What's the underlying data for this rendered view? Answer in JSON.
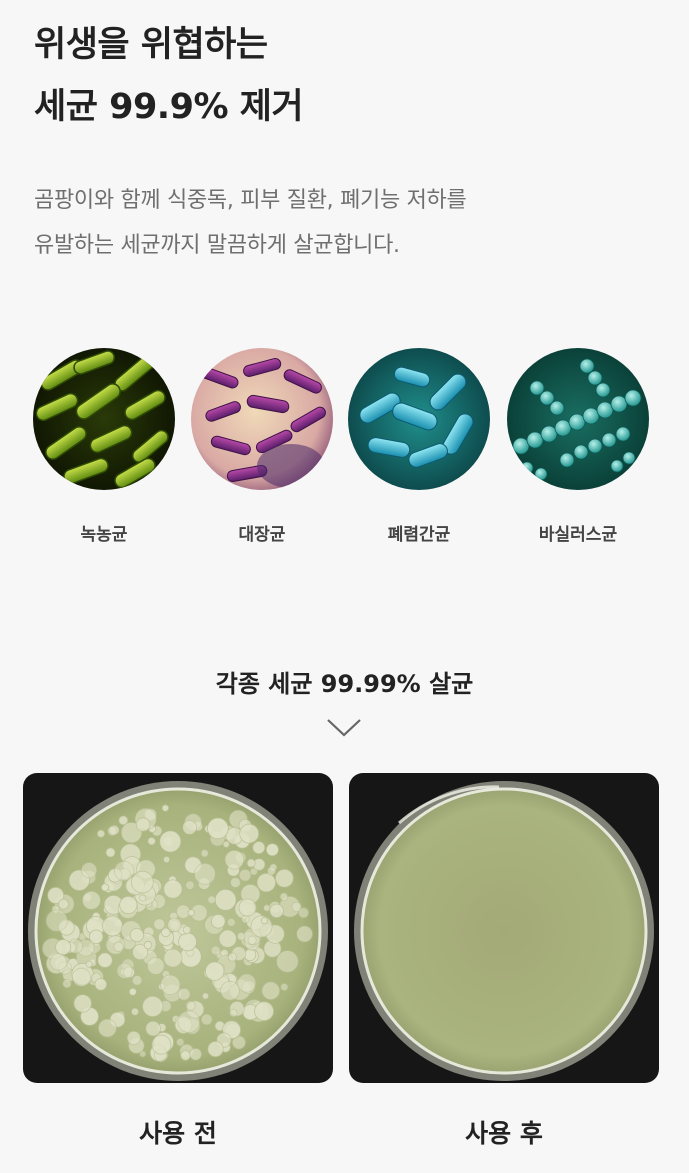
{
  "headline": {
    "line1": "위생을 위협하는",
    "line2": "세균 99.9% 제거"
  },
  "description": {
    "line1": "곰팡이와 함께 식중독, 피부 질환, 폐기능 저하를",
    "line2": "유발하는 세균까지 말끔하게 살균합니다."
  },
  "bacteria": [
    {
      "label": "녹농균",
      "icon": "pseudomonas-image"
    },
    {
      "label": "대장균",
      "icon": "e-coli-image"
    },
    {
      "label": "폐렴간균",
      "icon": "klebsiella-image"
    },
    {
      "label": "바실러스균",
      "icon": "bacillus-image"
    }
  ],
  "sterilization": {
    "title": "각종 세균 99.99% 살균",
    "arrow_icon": "chevron-down-icon"
  },
  "comparison": {
    "before_label": "사용 전",
    "after_label": "사용 후"
  },
  "colors": {
    "background": "#f7f7f7",
    "headline": "#222222",
    "description": "#6f6f6f"
  }
}
